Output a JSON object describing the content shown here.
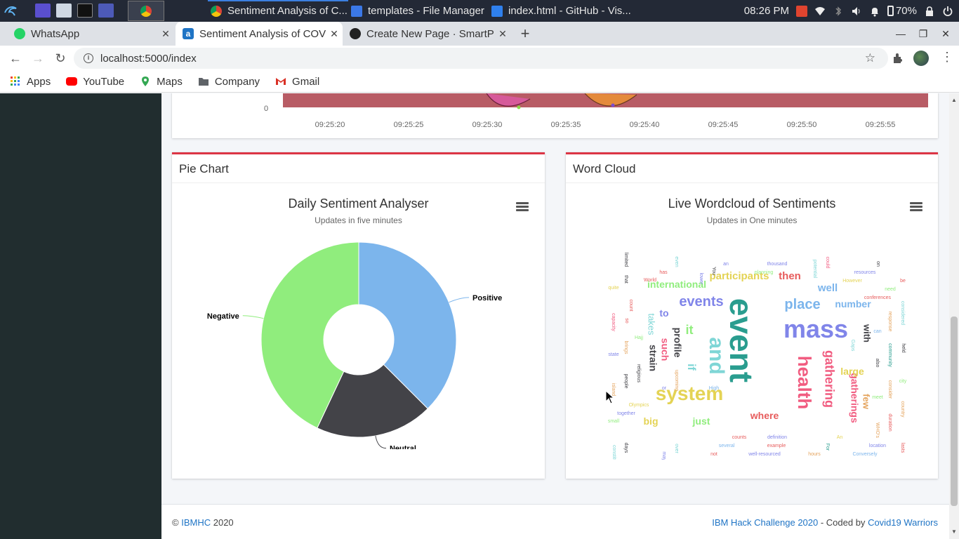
{
  "taskbar": {
    "windows": [
      {
        "title": "Sentiment Analysis of C...",
        "icon": "chrome-icon"
      },
      {
        "title": "templates - File Manager",
        "icon": "folder-icon"
      },
      {
        "title": "index.html - GitHub - Vis...",
        "icon": "vscode-icon"
      }
    ],
    "clock": "08:26 PM",
    "battery": "70%"
  },
  "browser": {
    "tabs": [
      {
        "title": "WhatsApp",
        "icon": "whatsapp-icon"
      },
      {
        "title": "Sentiment Analysis of COVID",
        "icon": "app-icon"
      },
      {
        "title": "Create New Page · SmartP",
        "icon": "github-icon"
      }
    ],
    "url": "localhost:5000/index",
    "bookmarks": [
      "Apps",
      "YouTube",
      "Maps",
      "Company",
      "Gmail"
    ]
  },
  "timeline": {
    "y_tick": "0",
    "x_ticks": [
      "09:25:20",
      "09:25:25",
      "09:25:30",
      "09:25:35",
      "09:25:40",
      "09:25:45",
      "09:25:50",
      "09:25:55"
    ],
    "colors": {
      "band": "#b85c65",
      "bubble_pink": "#d65a9a",
      "bubble_orange": "#e48a3b"
    }
  },
  "pie_card": {
    "header": "Pie Chart",
    "title": "Daily Sentiment Analyser",
    "subtitle": "Updates in five minutes"
  },
  "wordcloud_card": {
    "header": "Word Cloud",
    "title": "Live Wordcloud of Sentiments",
    "subtitle": "Updates in One minutes"
  },
  "chart_data": {
    "type": "pie",
    "donut": true,
    "title": "Daily Sentiment Analyser",
    "subtitle": "Updates in five minutes",
    "categories": [
      "Positive",
      "Neutral",
      "Negative"
    ],
    "values": [
      37.5,
      19.5,
      43
    ],
    "colors": [
      "#7cb5ec",
      "#434348",
      "#90ed7d"
    ]
  },
  "footer": {
    "copy": "©",
    "org": "IBMHC",
    "year": "2020",
    "event": "IBM Hack Challenge 2020",
    "coded_by": " - Coded by ",
    "team": "Covid19 Warriors"
  }
}
